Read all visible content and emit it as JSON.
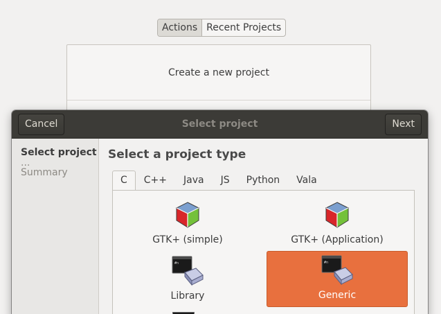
{
  "mode_switch": {
    "actions": "Actions",
    "recent_projects": "Recent Projects"
  },
  "background": {
    "create_new_project": "Create a new project"
  },
  "dialog": {
    "cancel": "Cancel",
    "title": "Select project",
    "next": "Next",
    "sidebar": {
      "step1": "Select project",
      "dots": "...",
      "step2": "Summary"
    },
    "heading": "Select a project type",
    "tabs": [
      "C",
      "C++",
      "Java",
      "JS",
      "Python",
      "Vala"
    ],
    "active_tab": "C",
    "templates": [
      {
        "label": "GTK+ (simple)",
        "icon": "gtk-cube-icon",
        "selected": false
      },
      {
        "label": "GTK+ (Application)",
        "icon": "gtk-cube-icon",
        "selected": false
      },
      {
        "label": "Library",
        "icon": "terminal-window-icon",
        "selected": false
      },
      {
        "label": "Generic",
        "icon": "terminal-window-icon",
        "selected": true
      }
    ],
    "selection_color": "#e8703e",
    "headerbar_color": "#3c3b37"
  }
}
